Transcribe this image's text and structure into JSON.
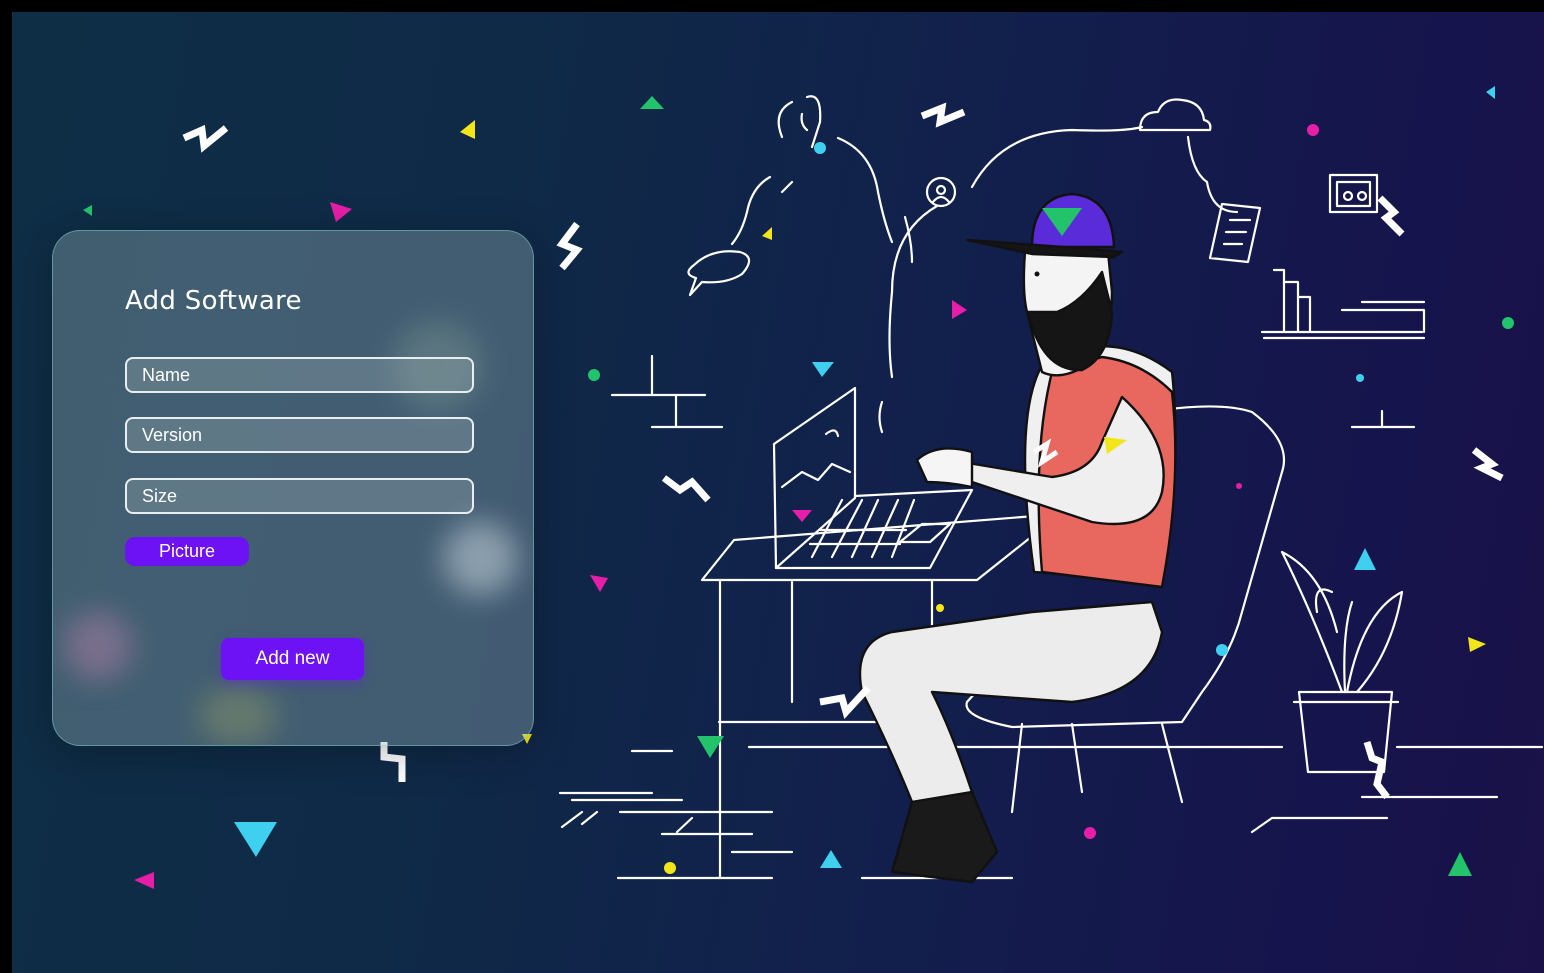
{
  "form": {
    "title": "Add Software",
    "name_placeholder": "Name",
    "version_placeholder": "Version",
    "size_placeholder": "Size",
    "picture_label": "Picture",
    "submit_label": "Add new"
  },
  "colors": {
    "accent": "#6d12f5",
    "confetti_green": "#22c36a",
    "confetti_pink": "#e61ea8",
    "confetti_yellow": "#f2e61a",
    "confetti_cyan": "#3fd0ef",
    "shirt": "#e8675e",
    "cap": "#5a2bd8"
  },
  "illustration": {
    "subject": "developer-at-laptop",
    "icons": [
      "chat-bubble-icon",
      "hand-raise-icon",
      "user-pin-icon",
      "cloud-icon",
      "document-icon",
      "photo-frame-icon",
      "books-icon",
      "plant-icon"
    ]
  }
}
